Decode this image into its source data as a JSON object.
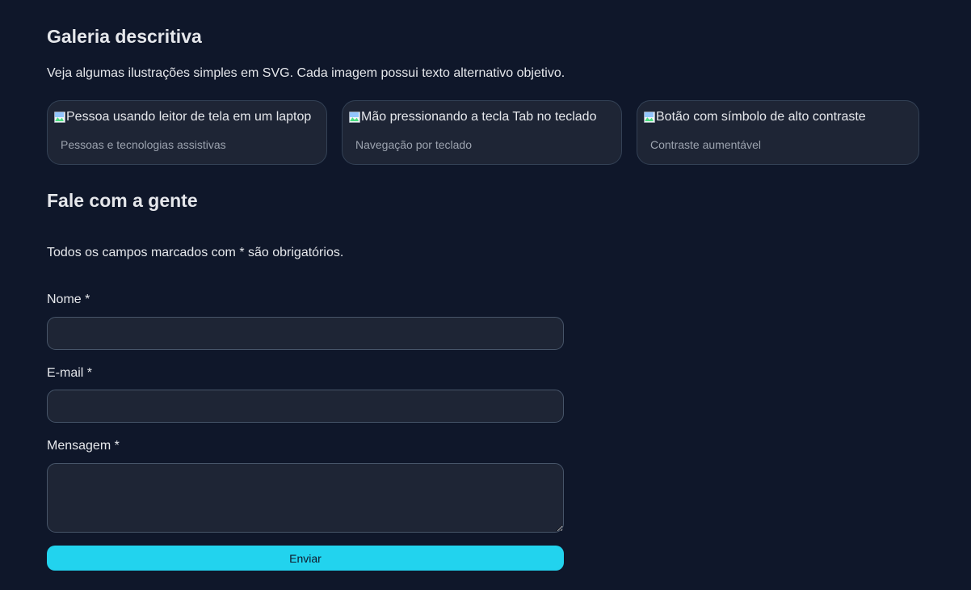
{
  "gallery": {
    "title": "Galeria descritiva",
    "description": "Veja algumas ilustrações simples em SVG. Cada imagem possui texto alternativo objetivo.",
    "items": [
      {
        "alt": "Pessoa usando leitor de tela em um laptop",
        "caption": "Pessoas e tecnologias assistivas",
        "icon": "broken-image-icon"
      },
      {
        "alt": "Mão pressionando a tecla Tab no teclado",
        "caption": "Navegação por teclado",
        "icon": "broken-image-icon"
      },
      {
        "alt": "Botão com símbolo de alto contraste",
        "caption": "Contraste aumentável",
        "icon": "broken-image-icon"
      }
    ]
  },
  "contact": {
    "title": "Fale com a gente",
    "required_note": "Todos os campos marcados com * são obrigatórios.",
    "fields": {
      "name": {
        "label": "Nome *",
        "value": "",
        "placeholder": ""
      },
      "email": {
        "label": "E-mail *",
        "value": "",
        "placeholder": ""
      },
      "message": {
        "label": "Mensagem *",
        "value": "",
        "placeholder": ""
      }
    },
    "submit_label": "Enviar"
  },
  "colors": {
    "background": "#0f172a",
    "card": "#1e2535",
    "accent": "#22d3ee",
    "muted_text": "#9ca3af"
  }
}
